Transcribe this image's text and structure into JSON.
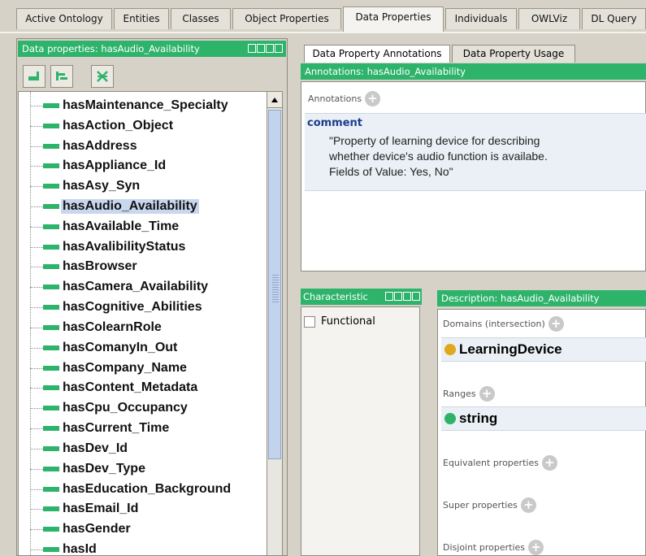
{
  "top_tabs": [
    "Active Ontology",
    "Entities",
    "Classes",
    "Object Properties",
    "Data Properties",
    "Individuals",
    "OWLViz",
    "DL Query"
  ],
  "active_top_tab": "Data Properties",
  "left_panel": {
    "title": "Data properties: hasAudio_Availability",
    "tools": [
      "add-subproperty-icon",
      "add-sibling-icon",
      "delete-property-icon"
    ],
    "items": [
      "hasMaintenance_Specialty",
      "hasAction_Object",
      "hasAddress",
      "hasAppliance_Id",
      "hasAsy_Syn",
      "hasAudio_Availability",
      "hasAvailable_Time",
      "hasAvalibilityStatus",
      "hasBrowser",
      "hasCamera_Availability",
      "hasCognitive_Abilities",
      "hasColearnRole",
      "hasComanyIn_Out",
      "hasCompany_Name",
      "hasContent_Metadata",
      "hasCpu_Occupancy",
      "hasCurrent_Time",
      "hasDev_Id",
      "hasDev_Type",
      "hasEducation_Background",
      "hasEmail_Id",
      "hasGender",
      "hasId"
    ],
    "selected": "hasAudio_Availability"
  },
  "annotations": {
    "tabs": [
      "Data Property Annotations",
      "Data Property Usage"
    ],
    "header": "Annotations: hasAudio_Availability",
    "section_label": "Annotations",
    "comment_label": "comment",
    "comment_text": "\"Property of learning device for describing\nwhether device's audio function is availabe.\nFields of Value: Yes, No\""
  },
  "characteristics": {
    "header": "Characteristic",
    "functional_label": "Functional",
    "functional_checked": false
  },
  "description": {
    "header": "Description: hasAudio_Availability",
    "domains_label": "Domains (intersection)",
    "domain_value": "LearningDevice",
    "ranges_label": "Ranges",
    "range_value": "string",
    "equivalent_label": "Equivalent properties",
    "super_label": "Super properties",
    "disjoint_label": "Disjoint properties"
  },
  "colors": {
    "header_green": "#2eb36b",
    "class_dot": "#e0a91c",
    "datatype_dot": "#2eb36b",
    "selection": "#c7d7ee"
  }
}
